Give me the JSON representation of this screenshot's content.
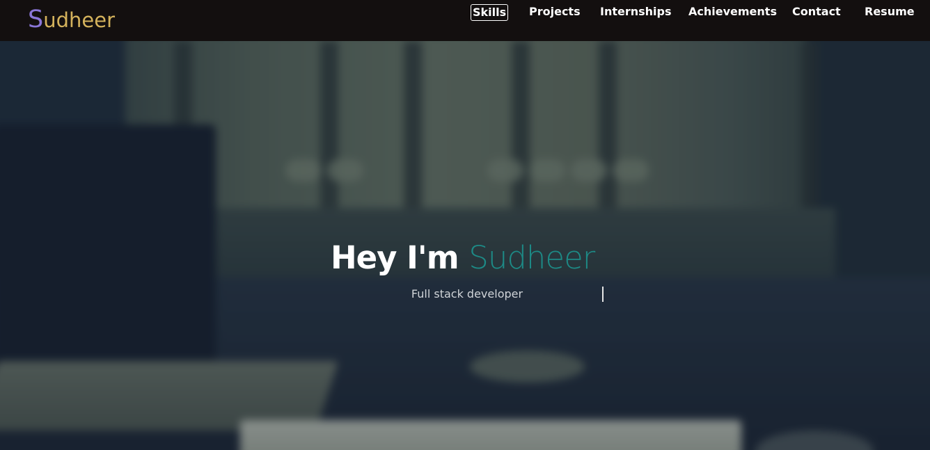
{
  "brand": {
    "initial": "S",
    "rest": "udheer",
    "initial_color": "#8a76d8",
    "rest_color": "#d4b25c"
  },
  "nav": {
    "items": [
      {
        "label": "Skills",
        "active": true
      },
      {
        "label": "Projects",
        "active": false
      },
      {
        "label": "Internships",
        "active": false
      },
      {
        "label": "Achievements",
        "active": false
      },
      {
        "label": "Contact",
        "active": false
      },
      {
        "label": "Resume",
        "active": false
      }
    ]
  },
  "hero": {
    "title_lead": "Hey I'm",
    "title_name": "Sudheer",
    "subtitle": "Full stack developer",
    "accent_color": "#1d8a86"
  },
  "colors": {
    "navbar_bg": "#130f0f",
    "text": "#ffffff"
  }
}
